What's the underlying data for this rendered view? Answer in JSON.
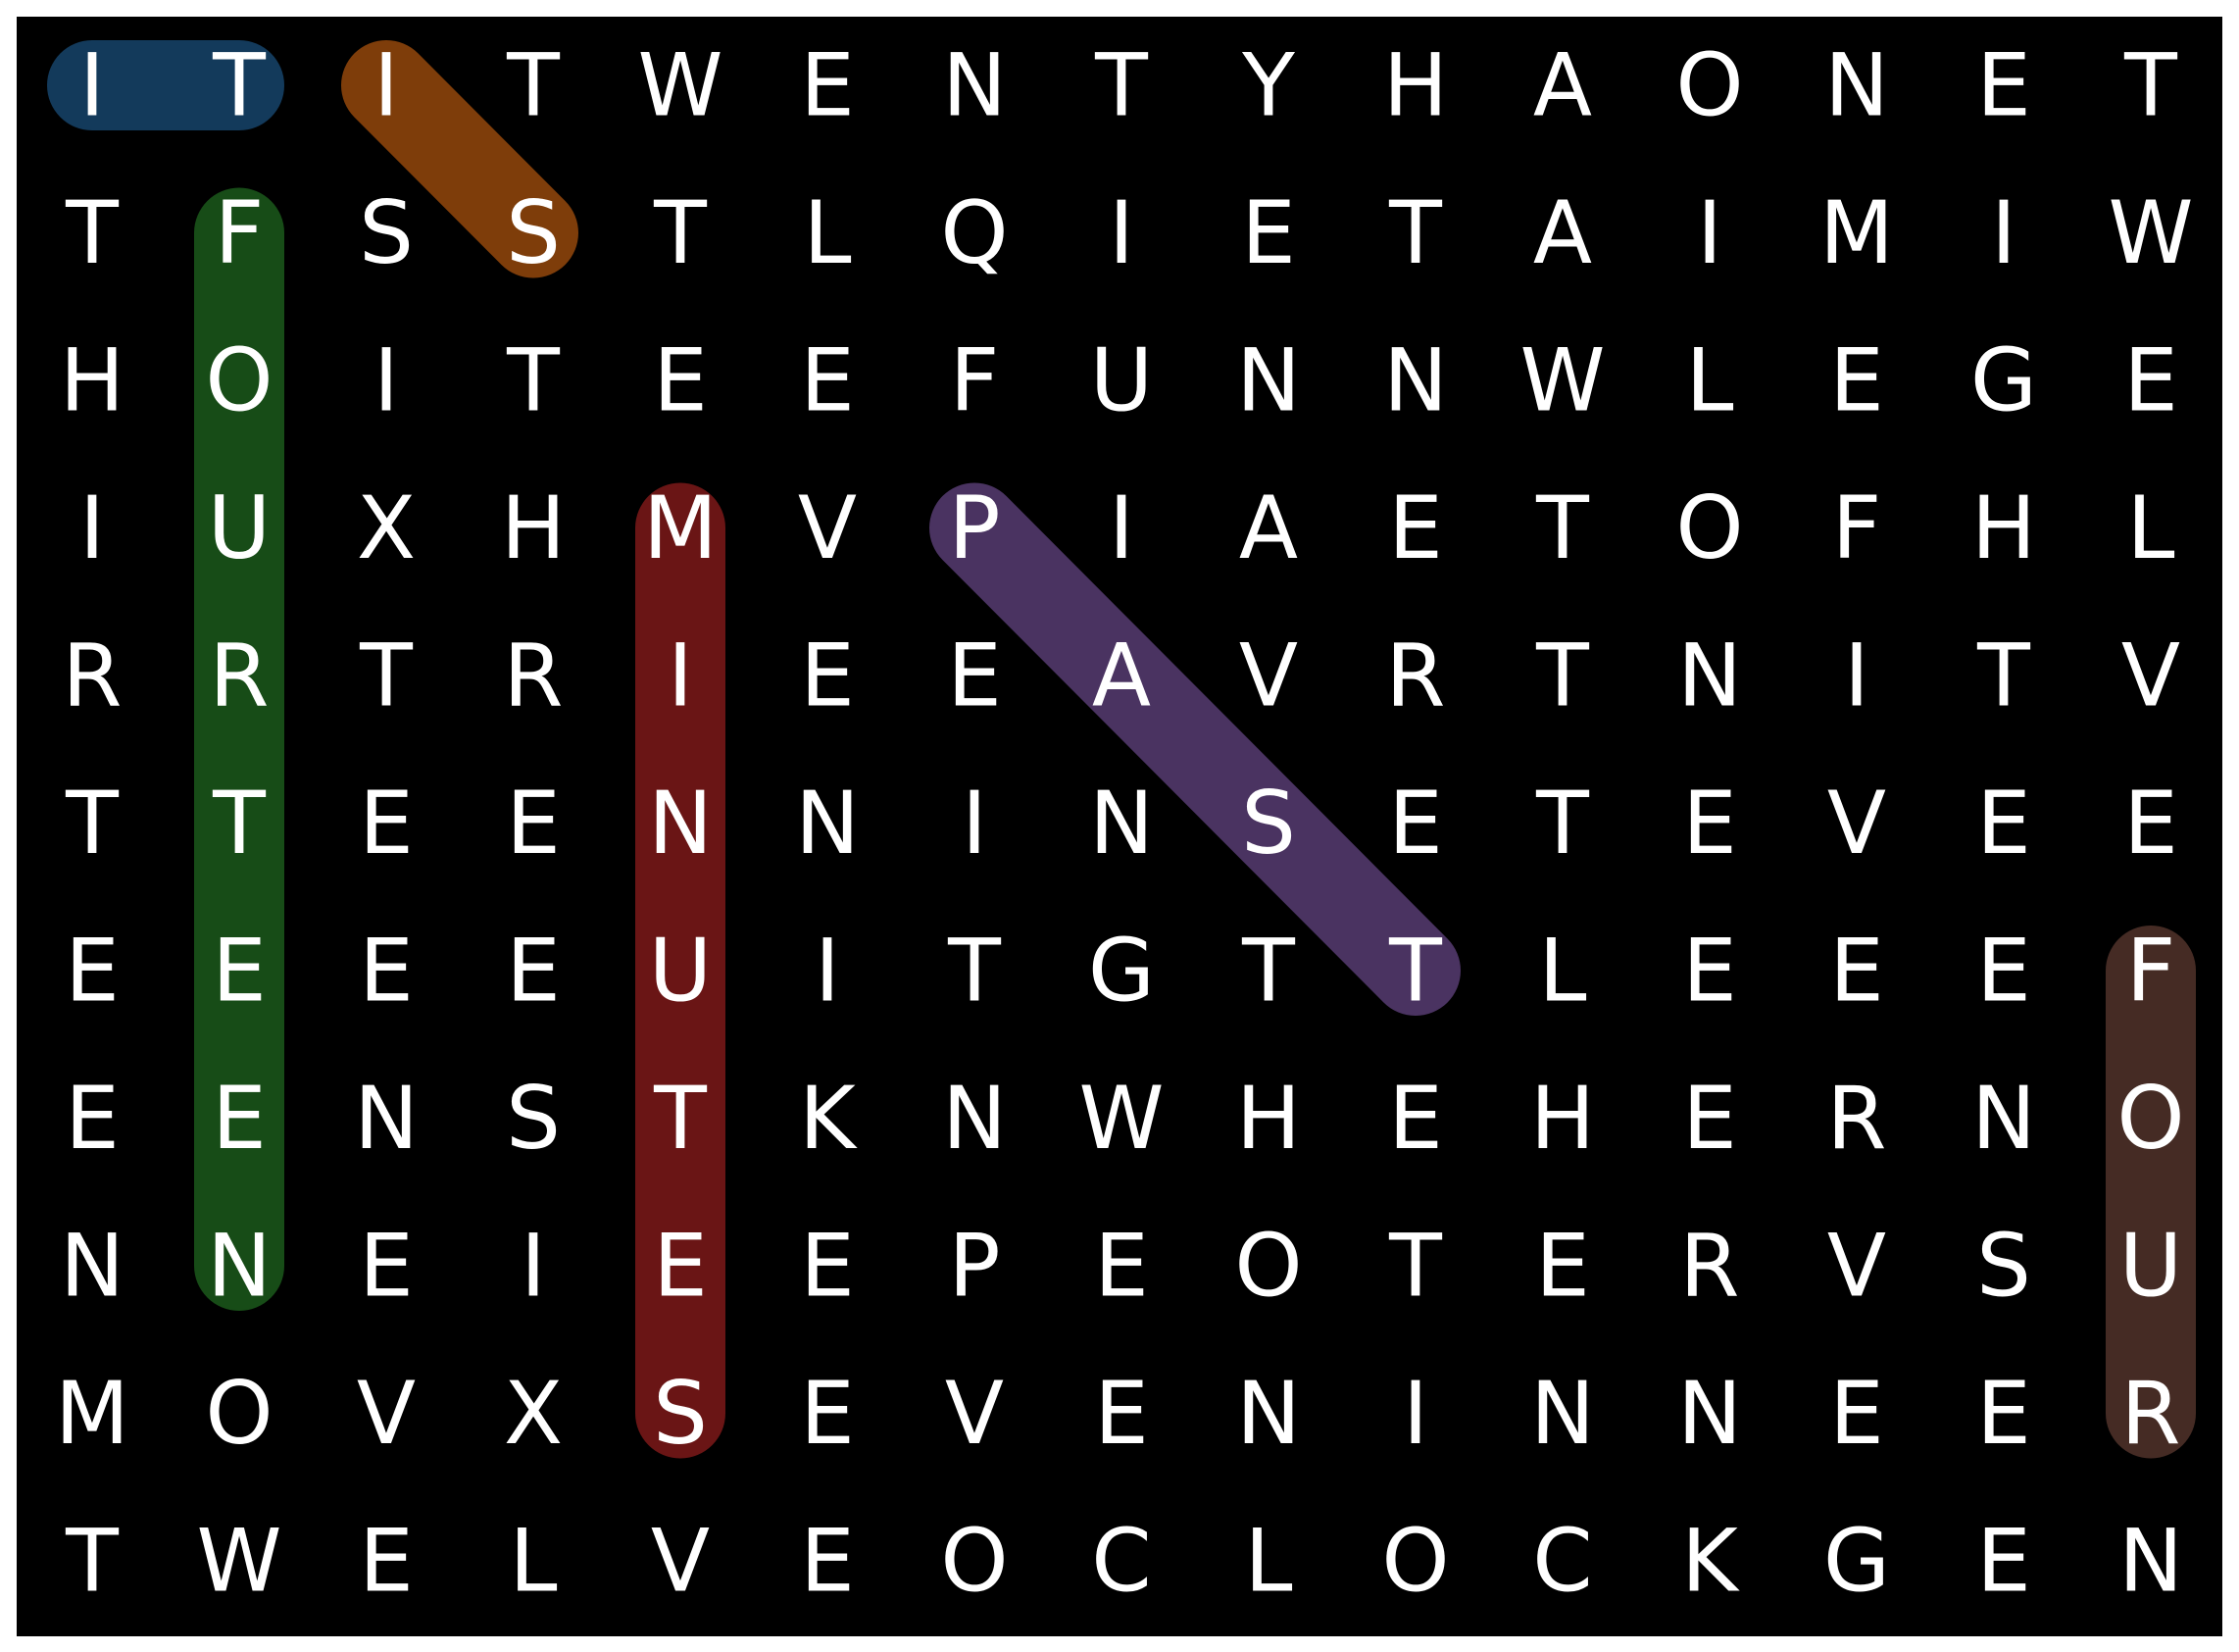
{
  "puzzle": {
    "grid": [
      "ITITWENTYHAONET",
      "TFSSTLQIETAIMIW",
      "HOITEEFUNNWLEGE",
      "IUXHMVPIAETOFHL",
      "RRTRIEEAVRTNITV",
      "TTEENNINSETEVEE",
      "EEEEUITGTTLEEEF",
      "EENSTKNWHEHERNO",
      "NNEIEEPEOTERVSU",
      "MOVXSEVENINNEER",
      "TWELVEOCLOCKGEN"
    ],
    "found_words": [
      {
        "word": "IT",
        "start": [
          0,
          0
        ],
        "end": [
          0,
          1
        ],
        "color": "#133a5b"
      },
      {
        "word": "IS",
        "start": [
          0,
          2
        ],
        "end": [
          1,
          3
        ],
        "color": "#7e3d0a"
      },
      {
        "word": "FOURTEEN",
        "start": [
          1,
          1
        ],
        "end": [
          8,
          1
        ],
        "color": "#174c17"
      },
      {
        "word": "MINUTES",
        "start": [
          3,
          4
        ],
        "end": [
          9,
          4
        ],
        "color": "#6a1515"
      },
      {
        "word": "PAST",
        "start": [
          3,
          6
        ],
        "end": [
          6,
          9
        ],
        "color": "#4a3361"
      },
      {
        "word": "FOUR",
        "start": [
          6,
          14
        ],
        "end": [
          9,
          14
        ],
        "color": "#452b24"
      }
    ]
  }
}
